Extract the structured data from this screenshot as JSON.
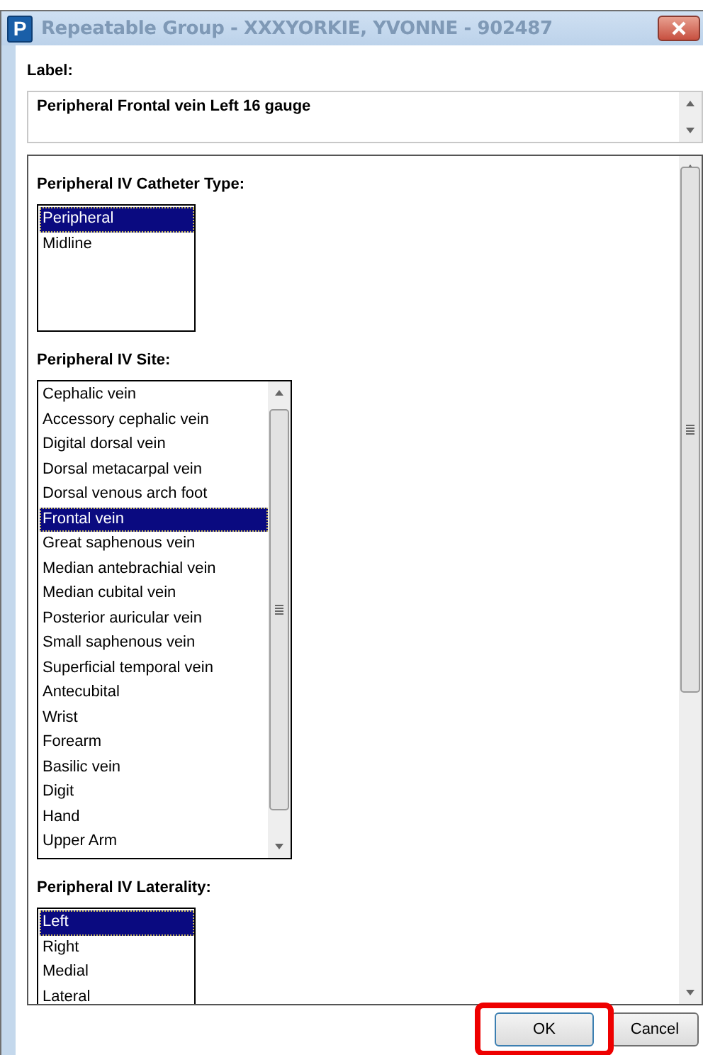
{
  "window": {
    "title": "Repeatable Group - XXXYORKIE, YVONNE - 902487",
    "logo": "P"
  },
  "label": {
    "heading": "Label:",
    "value": "Peripheral Frontal vein Left 16 gauge"
  },
  "fields": [
    {
      "heading": "Peripheral IV Catheter Type:",
      "kind": "short",
      "options": [
        {
          "text": "Peripheral",
          "selected": true
        },
        {
          "text": "Midline",
          "selected": false
        }
      ]
    },
    {
      "heading": "Peripheral IV Site:",
      "kind": "scrolling",
      "options": [
        {
          "text": "Cephalic vein",
          "selected": false
        },
        {
          "text": "Accessory cephalic vein",
          "selected": false
        },
        {
          "text": "Digital dorsal vein",
          "selected": false
        },
        {
          "text": "Dorsal metacarpal vein",
          "selected": false
        },
        {
          "text": "Dorsal venous arch foot",
          "selected": false
        },
        {
          "text": "Frontal vein",
          "selected": true
        },
        {
          "text": "Great saphenous vein",
          "selected": false
        },
        {
          "text": "Median antebrachial vein",
          "selected": false
        },
        {
          "text": "Median cubital vein",
          "selected": false
        },
        {
          "text": "Posterior auricular vein",
          "selected": false
        },
        {
          "text": "Small saphenous vein",
          "selected": false
        },
        {
          "text": "Superficial temporal vein",
          "selected": false
        },
        {
          "text": "Antecubital",
          "selected": false
        },
        {
          "text": "Wrist",
          "selected": false
        },
        {
          "text": "Forearm",
          "selected": false
        },
        {
          "text": "Basilic vein",
          "selected": false
        },
        {
          "text": "Digit",
          "selected": false
        },
        {
          "text": "Hand",
          "selected": false
        },
        {
          "text": "Upper Arm",
          "selected": false
        }
      ]
    },
    {
      "heading": "Peripheral IV Laterality:",
      "kind": "cut",
      "options": [
        {
          "text": "Left",
          "selected": true
        },
        {
          "text": "Right",
          "selected": false
        },
        {
          "text": "Medial",
          "selected": false
        },
        {
          "text": "Lateral",
          "selected": false
        }
      ]
    }
  ],
  "buttons": [
    {
      "label": "OK",
      "highlighted": true
    },
    {
      "label": "Cancel",
      "highlighted": false
    }
  ]
}
